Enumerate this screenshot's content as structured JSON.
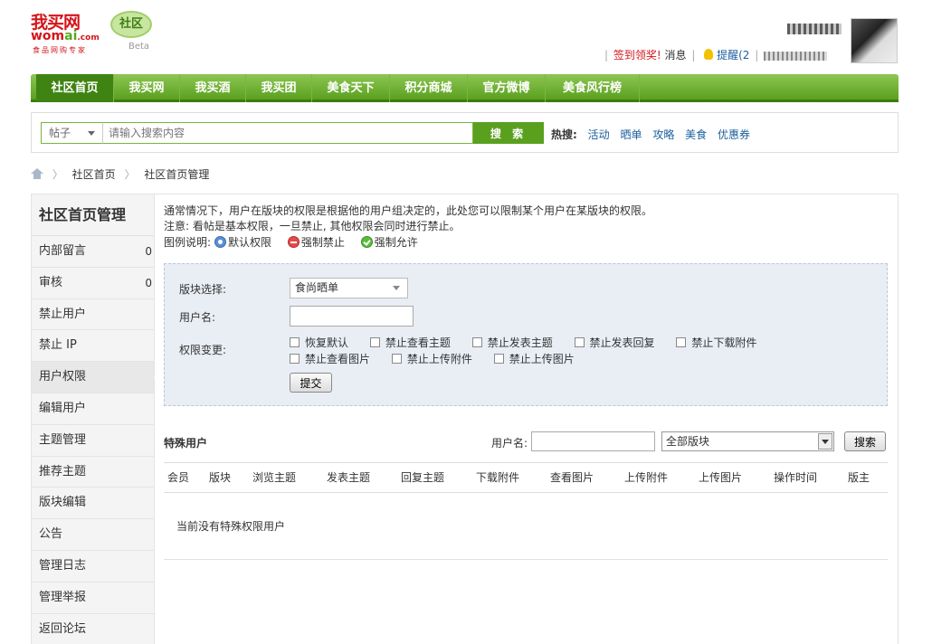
{
  "header": {
    "logo_main": "我买网",
    "logo_sub_a": "wom",
    "logo_sub_b": "ai",
    "logo_sub_c": ".com",
    "logo_tag": "食品网购专家",
    "community": "社区",
    "beta": "Beta",
    "user_links": {
      "checkin": "签到领奖!",
      "messages": "消息",
      "reminder": "提醒(2"
    }
  },
  "nav": {
    "items": [
      "社区首页",
      "我买网",
      "我买酒",
      "我买团",
      "美食天下",
      "积分商城",
      "官方微博",
      "美食风行榜"
    ]
  },
  "search": {
    "type": "帖子",
    "placeholder": "请输入搜索内容",
    "button": "搜 索",
    "hot_label": "热搜:",
    "hot": [
      "活动",
      "晒单",
      "攻略",
      "美食",
      "优惠券"
    ]
  },
  "breadcrumb": {
    "items": [
      "社区首页",
      "社区首页管理"
    ]
  },
  "sidebar": {
    "title": "社区首页管理",
    "items": [
      {
        "label": "内部留言",
        "count": "0"
      },
      {
        "label": "审核",
        "count": "0"
      },
      {
        "label": "禁止用户",
        "count": ""
      },
      {
        "label": "禁止 IP",
        "count": ""
      },
      {
        "label": "用户权限",
        "count": ""
      },
      {
        "label": "编辑用户",
        "count": ""
      },
      {
        "label": "主题管理",
        "count": ""
      },
      {
        "label": "推荐主题",
        "count": ""
      },
      {
        "label": "版块编辑",
        "count": ""
      },
      {
        "label": "公告",
        "count": ""
      },
      {
        "label": "管理日志",
        "count": ""
      },
      {
        "label": "管理举报",
        "count": ""
      },
      {
        "label": "返回论坛",
        "count": ""
      }
    ],
    "active_index": 4
  },
  "content": {
    "notice1": "通常情况下，用户在版块的权限是根据他的用户组决定的，此处您可以限制某个用户在某版块的权限。",
    "notice2": "注意: 看帖是基本权限，一旦禁止, 其他权限会同时进行禁止。",
    "legend_label": "图例说明:",
    "legend_default": "默认权限",
    "legend_ban": "强制禁止",
    "legend_allow": "强制允许",
    "form": {
      "board_label": "版块选择:",
      "board_value": "食尚晒单",
      "username_label": "用户名:",
      "username_value": "",
      "perm_label": "权限变更:",
      "perm_options": [
        "恢复默认",
        "禁止查看主题",
        "禁止发表主题",
        "禁止发表回复",
        "禁止下载附件",
        "禁止查看图片",
        "禁止上传附件",
        "禁止上传图片"
      ],
      "submit": "提交"
    },
    "special": {
      "title": "特殊用户",
      "username_label": "用户名:",
      "board_select": "全部版块",
      "search_button": "搜索",
      "columns": [
        "会员",
        "版块",
        "浏览主题",
        "发表主题",
        "回复主题",
        "下载附件",
        "查看图片",
        "上传附件",
        "上传图片",
        "操作时间",
        "版主"
      ],
      "empty": "当前没有特殊权限用户"
    }
  }
}
